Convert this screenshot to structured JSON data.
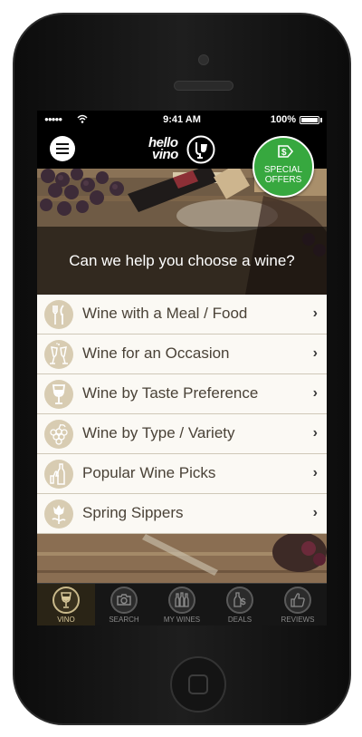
{
  "status_bar": {
    "signal": "●●●●●",
    "time": "9:41 AM",
    "battery": "100%"
  },
  "header": {
    "logo_line1": "hello",
    "logo_line2": "vino",
    "menu_icon": "hamburger-icon",
    "special_badge": {
      "line1": "SPECIAL",
      "line2": "OFFERS",
      "icon": "price-tag-dollar-icon",
      "color": "#37a83f"
    }
  },
  "hero": {
    "question": "Can we help you choose a wine?"
  },
  "menu": {
    "items": [
      {
        "label": "Wine with a Meal / Food",
        "icon": "fork-knife-icon"
      },
      {
        "label": "Wine for an Occasion",
        "icon": "champagne-toast-icon"
      },
      {
        "label": "Wine by Taste Preference",
        "icon": "wine-glass-icon"
      },
      {
        "label": "Wine by Type / Variety",
        "icon": "grapes-icon"
      },
      {
        "label": "Popular Wine Picks",
        "icon": "thumbs-up-bottle-icon"
      },
      {
        "label": "Spring Sippers",
        "icon": "tulip-flower-icon"
      }
    ]
  },
  "tabbar": {
    "tabs": [
      {
        "label": "VINO",
        "icon": "wine-glass-icon",
        "active": true
      },
      {
        "label": "SEARCH",
        "icon": "camera-icon",
        "active": false
      },
      {
        "label": "MY WINES",
        "icon": "bottles-icon",
        "active": false
      },
      {
        "label": "DEALS",
        "icon": "dollar-bottle-icon",
        "active": false
      },
      {
        "label": "REVIEWS",
        "icon": "thumbs-up-icon",
        "active": false
      }
    ]
  },
  "colors": {
    "accent_green": "#37a83f",
    "menu_bg": "#fbf9f4",
    "icon_circle": "#d8ccb2",
    "menu_text": "#4a4237",
    "tab_active": "#d8c89a"
  }
}
